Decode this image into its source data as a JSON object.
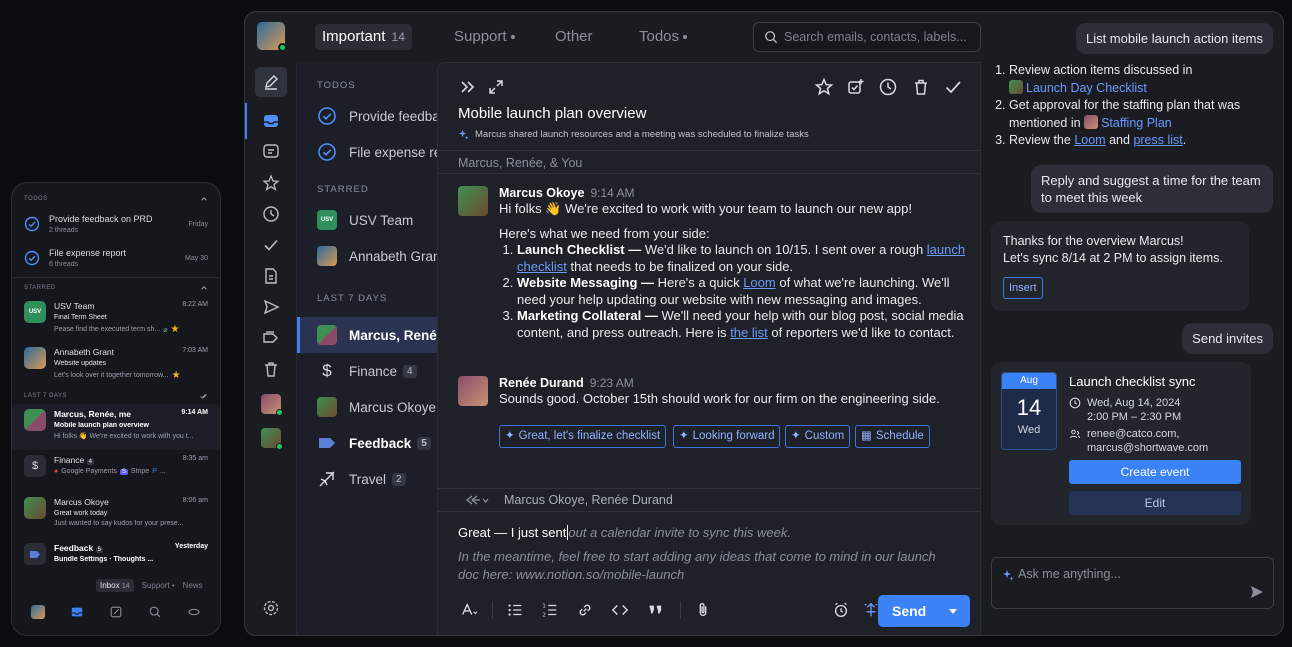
{
  "phone": {
    "todos_label": "TODOS",
    "todos": [
      {
        "title": "Provide feedback on PRD",
        "sub": "2 threads",
        "date": "Friday"
      },
      {
        "title": "File expense report",
        "sub": "6 threads",
        "date": "May 30"
      }
    ],
    "starred_label": "STARRED",
    "starred": [
      {
        "sender": "USV Team",
        "time": "8:22 AM",
        "subject": "Final Term Sheet",
        "preview": "Pease find the executed term sh..."
      },
      {
        "sender": "Annabeth Grant",
        "time": "7:03 AM",
        "subject": "Website updates",
        "preview": "Let's look over it together tomorrow..."
      }
    ],
    "last7_label": "LAST 7 DAYS",
    "recent": [
      {
        "sender": "Marcus, Renée, me",
        "time": "9:14 AM",
        "subject": "Mobile launch plan overview",
        "preview": "Hi folks 👋 We're excited to work with you t..."
      },
      {
        "sender": "Finance",
        "count": "4",
        "time": "8:35 am",
        "preview_a": "Google Payments",
        "preview_b": "Stripe",
        "preview_c": "..."
      },
      {
        "sender": "Marcus Okoye",
        "time": "8:06 am",
        "subject": "Great work today",
        "preview": "Just wanted to say kudos for your prese..."
      },
      {
        "sender": "Feedback",
        "count": "5",
        "time": "Yesterday",
        "preview": "Bundle Settings · Thoughts ..."
      }
    ],
    "tabs": {
      "inbox": "Inbox",
      "inbox_count": "14",
      "support": "Support",
      "news": "News"
    }
  },
  "topbar": {
    "tabs": [
      {
        "label": "Important",
        "count": "14"
      },
      {
        "label": "Support"
      },
      {
        "label": "Other"
      },
      {
        "label": "Todos"
      }
    ],
    "search_placeholder": "Search emails, contacts, labels..."
  },
  "list": {
    "todos_label": "TODOS",
    "todos": [
      "Provide feedback on PRD",
      "File expense report"
    ],
    "starred_label": "STARRED",
    "starred": [
      "USV Team",
      "Annabeth Grant"
    ],
    "usv_badge": "USV",
    "last7_label": "LAST 7 DAYS",
    "recent": [
      {
        "label": "Marcus, Renée, me"
      },
      {
        "label": "Finance",
        "count": "4"
      },
      {
        "label": "Marcus Okoye"
      },
      {
        "label": "Feedback",
        "count": "5"
      },
      {
        "label": "Travel",
        "count": "2"
      }
    ]
  },
  "thread": {
    "title": "Mobile launch plan overview",
    "summary": "Marcus shared launch resources and a meeting was scheduled to finalize tasks",
    "participants": "Marcus, Renée, & You",
    "msg1": {
      "sender": "Marcus Okoye",
      "time": "9:14 AM",
      "greeting": "Hi folks 👋 We're excited to work with your team to launch our new app!",
      "intro": "Here's what we need from your side:",
      "item1_title": "Launch Checklist —",
      "item1_a": " We'd like to launch on 10/15. I sent over a rough ",
      "item1_link": "launch checklist",
      "item1_b": " that needs to be finalized on your side.",
      "item2_title": "Website Messaging —",
      "item2_a": " Here's a quick ",
      "item2_link": "Loom",
      "item2_b": " of what we're launching. We'll need your help updating our website with new messaging and images.",
      "item3_title": "Marketing Collateral —",
      "item3_a": " We'll need your help with our blog post, social media content, and press outreach. Here is ",
      "item3_link": "the list",
      "item3_b": " of reporters we'd like to contact."
    },
    "msg2": {
      "sender": "Renée Durand",
      "time": "9:23 AM",
      "body": "Sounds good. October 15th should work for our firm on the engineering side."
    },
    "suggestions": [
      "Great, let's finalize checklist",
      "Looking forward",
      "Custom",
      "Schedule"
    ],
    "reply_to": "Marcus Okoye, Renée Durand",
    "compose_typed": "Great — I just sent",
    "compose_ghost": "out a calendar invite to sync this week.",
    "compose_ghost2": "In the meantime, feel free to start adding any ideas that come to mind in our launch doc here: www.notion.so/mobile-launch",
    "send_label": "Send"
  },
  "assistant": {
    "prompt1": "List mobile launch action items",
    "a1_item1_pre": "Review action items discussed in",
    "a1_item1_link": "Launch Day Checklist",
    "a1_item2_pre": "Get approval for the staffing plan that was mentioned in",
    "a1_item2_link": "Staffing Plan",
    "a1_item3_pre": "Review the",
    "a1_item3_link1": "Loom",
    "a1_item3_mid": "and",
    "a1_item3_link2": "press list",
    "a1_item3_end": ".",
    "prompt2": "Reply and suggest a time for the team to meet this week",
    "reply_line1": "Thanks for the overview Marcus!",
    "reply_line2": "Let's sync 8/14 at 2 PM to assign items.",
    "insert_label": "Insert",
    "prompt3": "Send invites",
    "event": {
      "month": "Aug",
      "day": "14",
      "weekday": "Wed",
      "title": "Launch checklist sync",
      "date": "Wed, Aug 14, 2024",
      "time": "2:00 PM – 2:30 PM",
      "guest1": "renee@catco.com,",
      "guest2": "marcus@shortwave.com",
      "create_label": "Create event",
      "edit_label": "Edit"
    },
    "ask_placeholder": "Ask me anything..."
  },
  "colors": {
    "accent": "#3b82f6",
    "link": "#6b9bff",
    "star": "#f5b324",
    "bg": "#1a1c22"
  }
}
